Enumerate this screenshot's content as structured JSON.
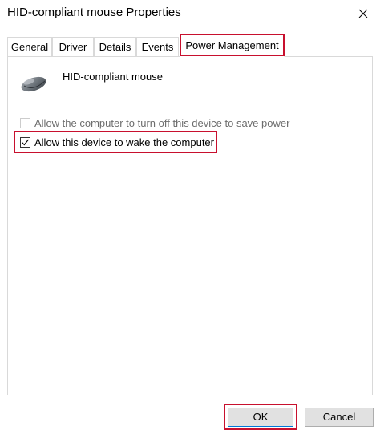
{
  "window": {
    "title": "HID-compliant mouse Properties"
  },
  "tabs": [
    {
      "label": "General"
    },
    {
      "label": "Driver"
    },
    {
      "label": "Details"
    },
    {
      "label": "Events"
    },
    {
      "label": "Power Management"
    }
  ],
  "active_tab": "Power Management",
  "device": {
    "name": "HID-compliant mouse",
    "icon": "mouse-icon"
  },
  "options": {
    "turn_off": {
      "label": "Allow the computer to turn off this device to save power",
      "checked": false,
      "enabled": false
    },
    "wake": {
      "label": "Allow this device to wake the computer",
      "checked": true,
      "enabled": true
    }
  },
  "buttons": {
    "ok": "OK",
    "cancel": "Cancel"
  },
  "colors": {
    "highlight": "#c8102e",
    "default_button_border": "#0078d7",
    "disabled_text": "#6d6d6d"
  }
}
